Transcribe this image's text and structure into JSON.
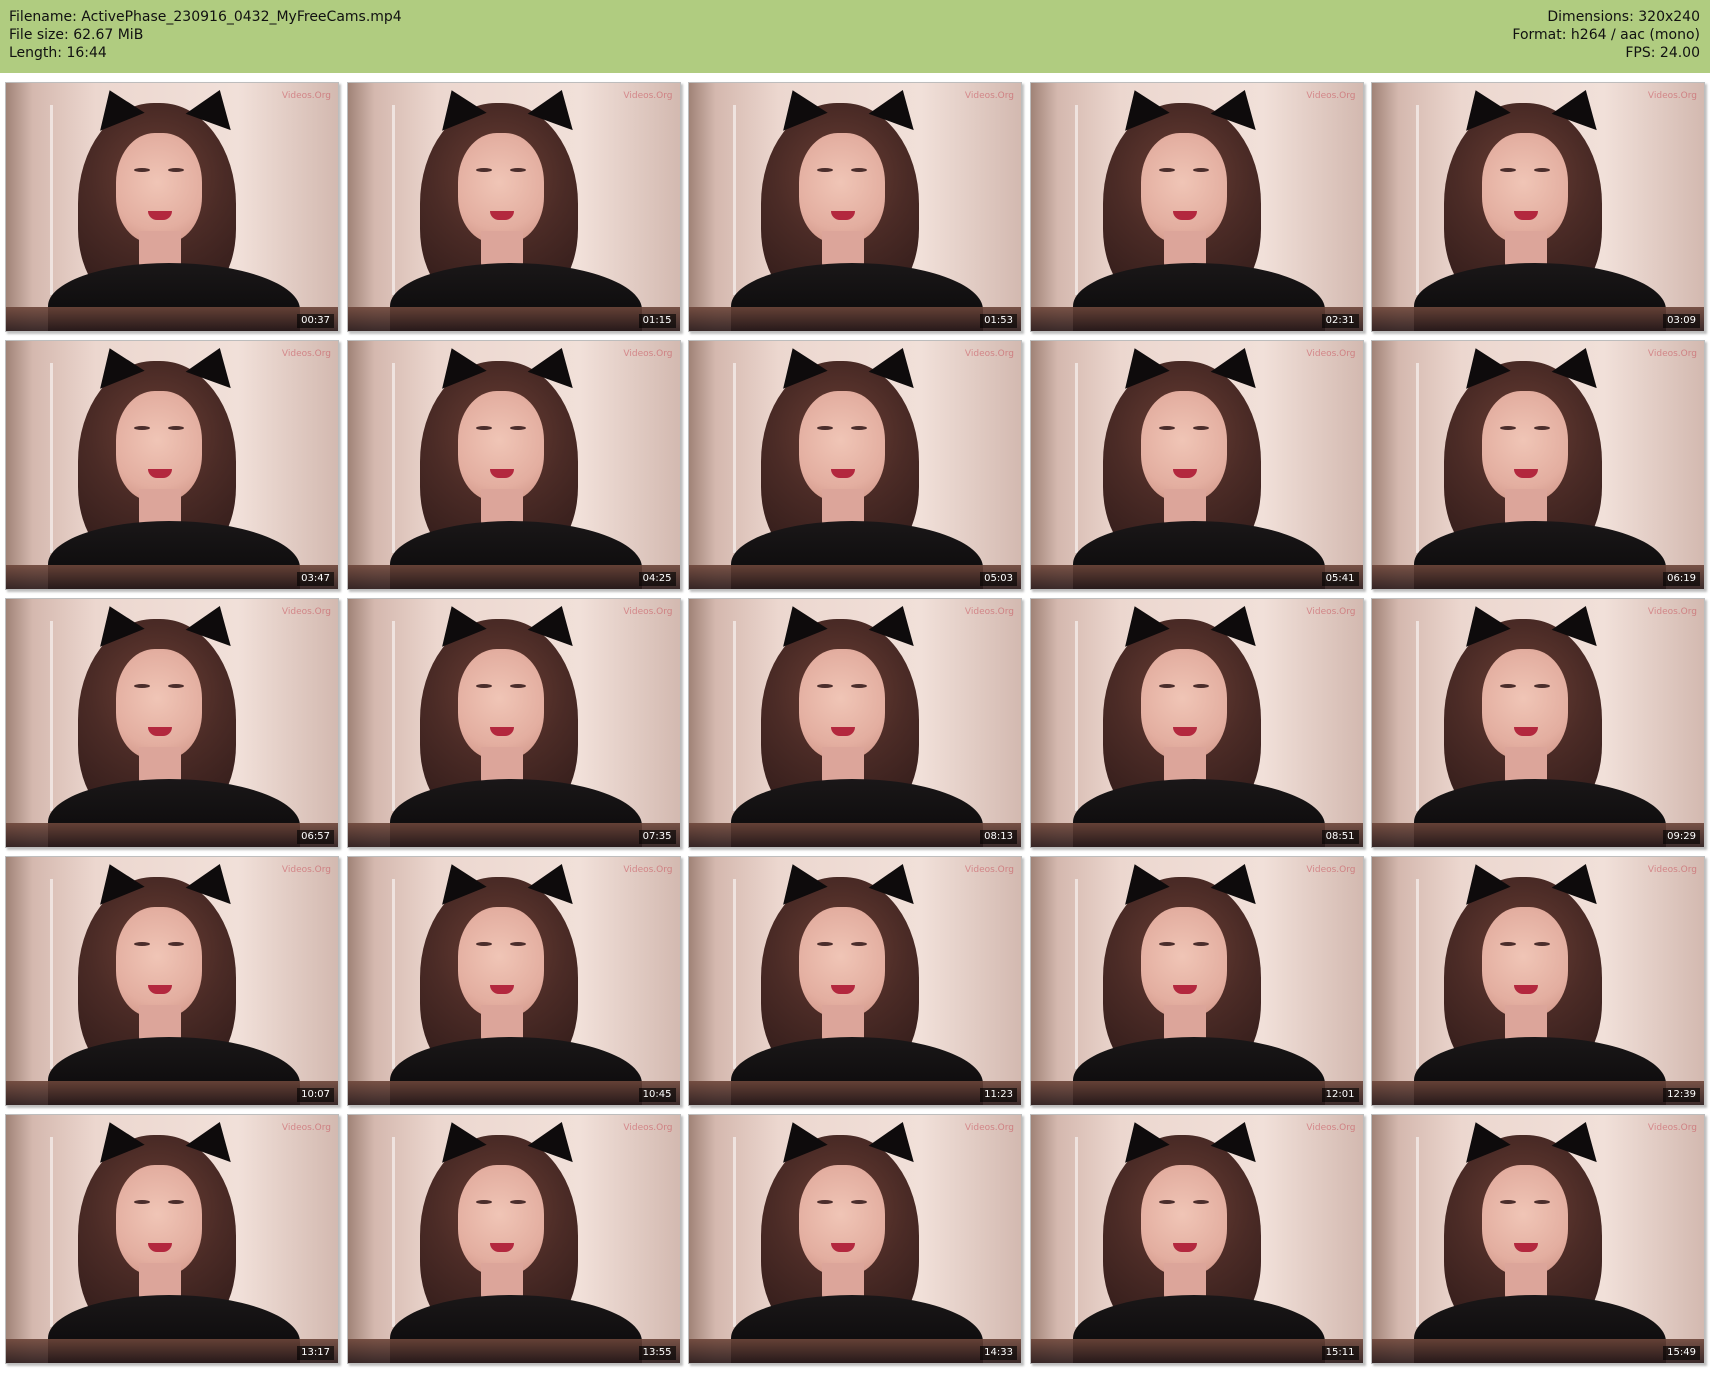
{
  "header": {
    "filename": "Filename: ActivePhase_230916_0432_MyFreeCams.mp4",
    "file_size": "File size: 62.67 MiB",
    "length": "Length: 16:44",
    "dimensions": "Dimensions: 320x240",
    "format": "Format: h264 / aac (mono)",
    "fps": "FPS: 24.00"
  },
  "thumbnails": [
    {
      "timestamp": "00:37"
    },
    {
      "timestamp": "01:15"
    },
    {
      "timestamp": "01:53"
    },
    {
      "timestamp": "02:31"
    },
    {
      "timestamp": "03:09"
    },
    {
      "timestamp": "03:47"
    },
    {
      "timestamp": "04:25"
    },
    {
      "timestamp": "05:03"
    },
    {
      "timestamp": "05:41"
    },
    {
      "timestamp": "06:19"
    },
    {
      "timestamp": "06:57"
    },
    {
      "timestamp": "07:35"
    },
    {
      "timestamp": "08:13"
    },
    {
      "timestamp": "08:51"
    },
    {
      "timestamp": "09:29"
    },
    {
      "timestamp": "10:07"
    },
    {
      "timestamp": "10:45"
    },
    {
      "timestamp": "11:23"
    },
    {
      "timestamp": "12:01"
    },
    {
      "timestamp": "12:39"
    },
    {
      "timestamp": "13:17"
    },
    {
      "timestamp": "13:55"
    },
    {
      "timestamp": "14:33"
    },
    {
      "timestamp": "15:11"
    },
    {
      "timestamp": "15:49"
    }
  ],
  "watermark": "Videos.Org",
  "colors": {
    "header_background": "#b0cc80",
    "timestamp_background": "#000000"
  }
}
